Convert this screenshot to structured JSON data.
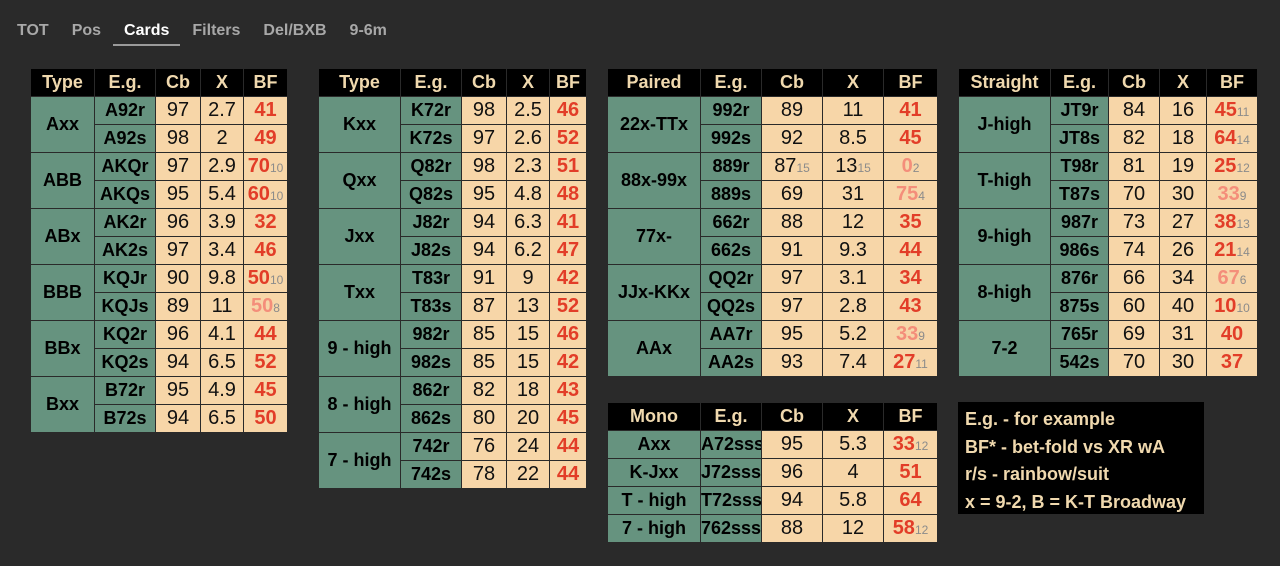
{
  "tabs": [
    "TOT",
    "Pos",
    "Cards",
    "Filters",
    "Del/BXB",
    "9-6m"
  ],
  "active_tab": "Cards",
  "colors": {
    "background": "#2a2a2a",
    "header_bg": "#000000",
    "header_text": "#f0d9ae",
    "label_bg": "#66937f",
    "value_bg": "#f7d6a8",
    "bf_text": "#e23d28",
    "bf_light_text": "#f48e7a"
  },
  "tables": [
    {
      "id": "t1",
      "headers": [
        "Type",
        "E.g.",
        "Cb",
        "X",
        "BF"
      ],
      "groups": [
        {
          "label": "Axx",
          "rows": [
            {
              "eg": "A92r",
              "cb": "97",
              "x": "2.7",
              "bf": "41"
            },
            {
              "eg": "A92s",
              "cb": "98",
              "x": "2",
              "bf": "49"
            }
          ]
        },
        {
          "label": "ABB",
          "rows": [
            {
              "eg": "AKQr",
              "cb": "97",
              "x": "2.9",
              "bf": "70",
              "bf_sub": "10"
            },
            {
              "eg": "AKQs",
              "cb": "95",
              "x": "5.4",
              "bf": "60",
              "bf_sub": "10"
            }
          ]
        },
        {
          "label": "ABx",
          "rows": [
            {
              "eg": "AK2r",
              "cb": "96",
              "x": "3.9",
              "bf": "32"
            },
            {
              "eg": "AK2s",
              "cb": "97",
              "x": "3.4",
              "bf": "46"
            }
          ]
        },
        {
          "label": "BBB",
          "rows": [
            {
              "eg": "KQJr",
              "cb": "90",
              "x": "9.8",
              "bf": "50",
              "bf_sub": "10"
            },
            {
              "eg": "KQJs",
              "cb": "89",
              "x": "11",
              "bf": "50",
              "bf_sub": "8",
              "bf_light": true
            }
          ]
        },
        {
          "label": "BBx",
          "rows": [
            {
              "eg": "KQ2r",
              "cb": "96",
              "x": "4.1",
              "bf": "44"
            },
            {
              "eg": "KQ2s",
              "cb": "94",
              "x": "6.5",
              "bf": "52"
            }
          ]
        },
        {
          "label": "Bxx",
          "rows": [
            {
              "eg": "B72r",
              "cb": "95",
              "x": "4.9",
              "bf": "45"
            },
            {
              "eg": "B72s",
              "cb": "94",
              "x": "6.5",
              "bf": "50"
            }
          ]
        }
      ]
    },
    {
      "id": "t2",
      "headers": [
        "Type",
        "E.g.",
        "Cb",
        "X",
        "BF"
      ],
      "groups": [
        {
          "label": "Kxx",
          "rows": [
            {
              "eg": "K72r",
              "cb": "98",
              "x": "2.5",
              "bf": "46"
            },
            {
              "eg": "K72s",
              "cb": "97",
              "x": "2.6",
              "bf": "52"
            }
          ]
        },
        {
          "label": "Qxx",
          "rows": [
            {
              "eg": "Q82r",
              "cb": "98",
              "x": "2.3",
              "bf": "51"
            },
            {
              "eg": "Q82s",
              "cb": "95",
              "x": "4.8",
              "bf": "48"
            }
          ]
        },
        {
          "label": "Jxx",
          "rows": [
            {
              "eg": "J82r",
              "cb": "94",
              "x": "6.3",
              "bf": "41"
            },
            {
              "eg": "J82s",
              "cb": "94",
              "x": "6.2",
              "bf": "47"
            }
          ]
        },
        {
          "label": "Txx",
          "rows": [
            {
              "eg": "T83r",
              "cb": "91",
              "x": "9",
              "bf": "42"
            },
            {
              "eg": "T83s",
              "cb": "87",
              "x": "13",
              "bf": "52"
            }
          ]
        },
        {
          "label": "9 - high",
          "rows": [
            {
              "eg": "982r",
              "cb": "85",
              "x": "15",
              "bf": "46"
            },
            {
              "eg": "982s",
              "cb": "85",
              "x": "15",
              "bf": "42"
            }
          ]
        },
        {
          "label": "8 - high",
          "rows": [
            {
              "eg": "862r",
              "cb": "82",
              "x": "18",
              "bf": "43"
            },
            {
              "eg": "862s",
              "cb": "80",
              "x": "20",
              "bf": "45"
            }
          ]
        },
        {
          "label": "7 - high",
          "rows": [
            {
              "eg": "742r",
              "cb": "76",
              "x": "24",
              "bf": "44"
            },
            {
              "eg": "742s",
              "cb": "78",
              "x": "22",
              "bf": "44"
            }
          ]
        }
      ]
    },
    {
      "id": "t3",
      "headers": [
        "Paired",
        "E.g.",
        "Cb",
        "X",
        "BF"
      ],
      "groups": [
        {
          "label": "22x-TTx",
          "rows": [
            {
              "eg": "992r",
              "cb": "89",
              "x": "11",
              "bf": "41"
            },
            {
              "eg": "992s",
              "cb": "92",
              "x": "8.5",
              "bf": "45"
            }
          ]
        },
        {
          "label": "88x-99x",
          "rows": [
            {
              "eg": "889r",
              "cb": "87",
              "cb_sub": "15",
              "x": "13",
              "x_sub": "15",
              "bf": "0",
              "bf_sub": "2",
              "bf_light": true
            },
            {
              "eg": "889s",
              "cb": "69",
              "x": "31",
              "bf": "75",
              "bf_sub": "4",
              "bf_light": true
            }
          ]
        },
        {
          "label": "77x-",
          "rows": [
            {
              "eg": "662r",
              "cb": "88",
              "x": "12",
              "bf": "35"
            },
            {
              "eg": "662s",
              "cb": "91",
              "x": "9.3",
              "bf": "44"
            }
          ]
        },
        {
          "label": "JJx-KKx",
          "rows": [
            {
              "eg": "QQ2r",
              "cb": "97",
              "x": "3.1",
              "bf": "34"
            },
            {
              "eg": "QQ2s",
              "cb": "97",
              "x": "2.8",
              "bf": "43"
            }
          ]
        },
        {
          "label": "AAx",
          "rows": [
            {
              "eg": "AA7r",
              "cb": "95",
              "x": "5.2",
              "bf": "33",
              "bf_sub": "9",
              "bf_light": true
            },
            {
              "eg": "AA2s",
              "cb": "93",
              "x": "7.4",
              "bf": "27",
              "bf_sub": "11"
            }
          ]
        }
      ]
    },
    {
      "id": "t4",
      "headers": [
        "Straight",
        "E.g.",
        "Cb",
        "X",
        "BF"
      ],
      "groups": [
        {
          "label": "J-high",
          "rows": [
            {
              "eg": "JT9r",
              "cb": "84",
              "x": "16",
              "bf": "45",
              "bf_sub": "11"
            },
            {
              "eg": "JT8s",
              "cb": "82",
              "x": "18",
              "bf": "64",
              "bf_sub": "14"
            }
          ]
        },
        {
          "label": "T-high",
          "rows": [
            {
              "eg": "T98r",
              "cb": "81",
              "x": "19",
              "bf": "25",
              "bf_sub": "12"
            },
            {
              "eg": "T87s",
              "cb": "70",
              "x": "30",
              "bf": "33",
              "bf_sub": "9",
              "bf_light": true
            }
          ]
        },
        {
          "label": "9-high",
          "rows": [
            {
              "eg": "987r",
              "cb": "73",
              "x": "27",
              "bf": "38",
              "bf_sub": "13"
            },
            {
              "eg": "986s",
              "cb": "74",
              "x": "26",
              "bf": "21",
              "bf_sub": "14"
            }
          ]
        },
        {
          "label": "8-high",
          "rows": [
            {
              "eg": "876r",
              "cb": "66",
              "x": "34",
              "bf": "67",
              "bf_sub": "6",
              "bf_light": true
            },
            {
              "eg": "875s",
              "cb": "60",
              "x": "40",
              "bf": "10",
              "bf_sub": "10"
            }
          ]
        },
        {
          "label": "7-2",
          "rows": [
            {
              "eg": "765r",
              "cb": "69",
              "x": "31",
              "bf": "40"
            },
            {
              "eg": "542s",
              "cb": "70",
              "x": "30",
              "bf": "37"
            }
          ]
        }
      ]
    },
    {
      "id": "t5",
      "headers": [
        "Mono",
        "E.g.",
        "Cb",
        "X",
        "BF"
      ],
      "groups": [
        {
          "label": "Axx",
          "rows": [
            {
              "eg": "A72sss",
              "cb": "95",
              "x": "5.3",
              "bf": "33",
              "bf_sub": "12"
            }
          ]
        },
        {
          "label": "K-Jxx",
          "rows": [
            {
              "eg": "J72sss",
              "cb": "96",
              "x": "4",
              "bf": "51"
            }
          ]
        },
        {
          "label": "T - high",
          "rows": [
            {
              "eg": "T72sss",
              "cb": "94",
              "x": "5.8",
              "bf": "64"
            }
          ]
        },
        {
          "label": "7 - high",
          "rows": [
            {
              "eg": "762sss",
              "cb": "88",
              "x": "12",
              "bf": "58",
              "bf_sub": "12"
            }
          ]
        }
      ]
    }
  ],
  "legend": [
    "E.g. - for example",
    "BF* - bet-fold vs XR wA",
    "r/s - rainbow/suit",
    "x = 9-2, B = K-T Broadway"
  ]
}
